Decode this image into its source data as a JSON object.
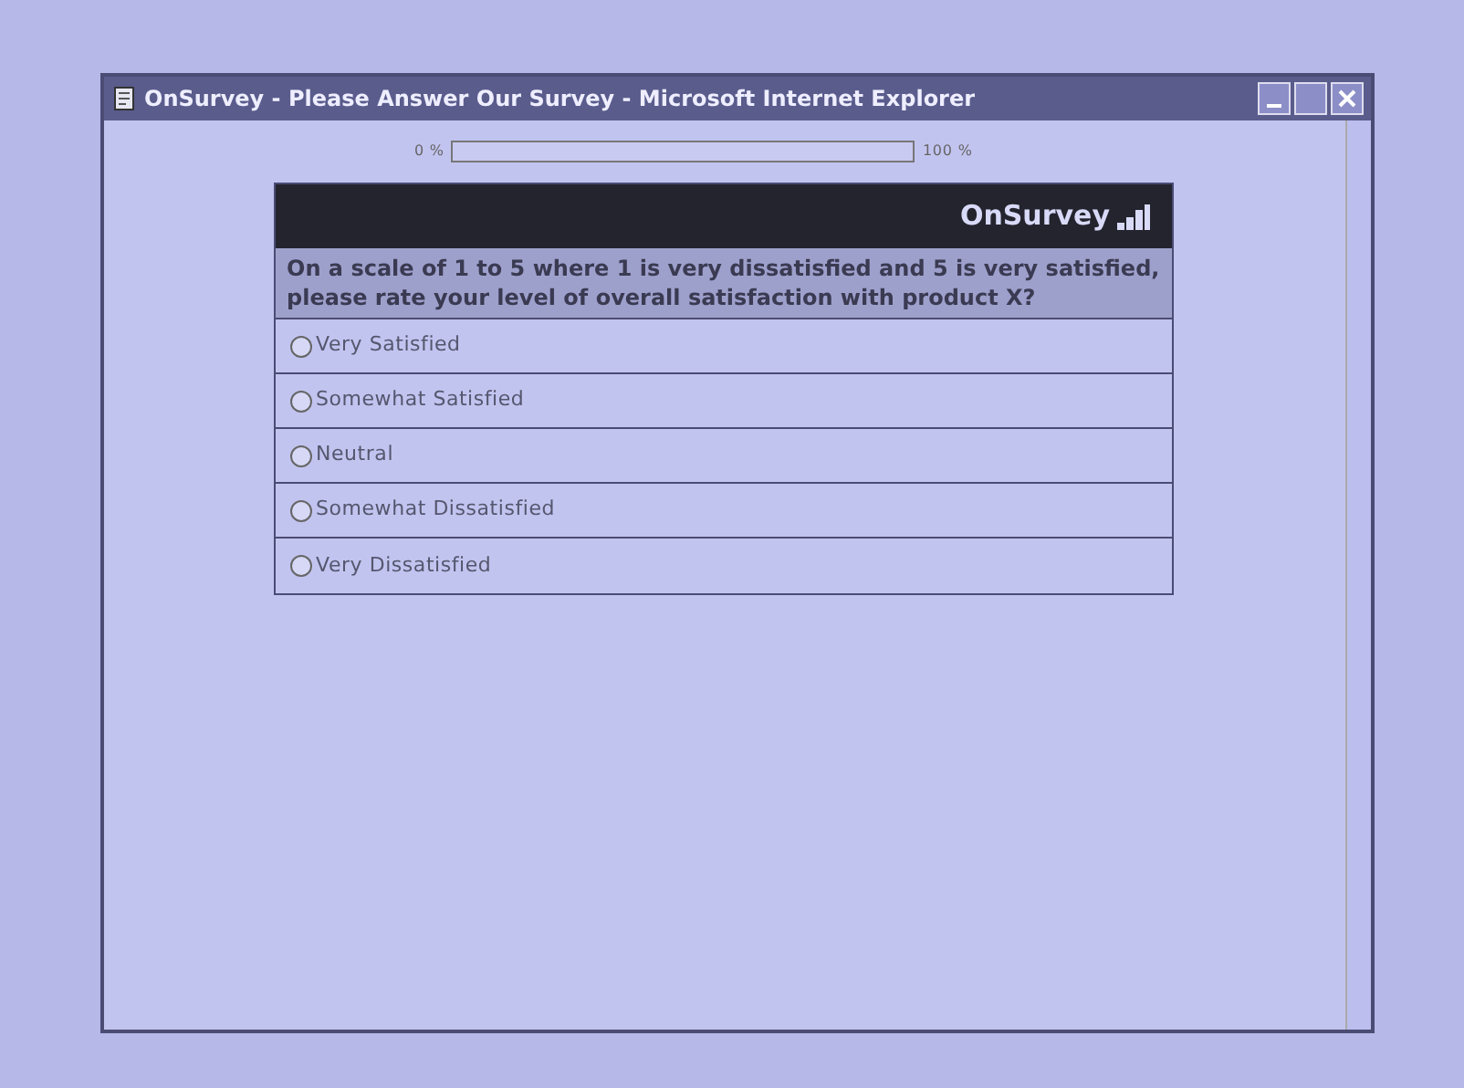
{
  "window": {
    "title": "OnSurvey - Please Answer Our Survey - Microsoft Internet Explorer"
  },
  "progress": {
    "start_label": "0 %",
    "end_label": "100 %",
    "level": 0
  },
  "survey": {
    "brand": "OnSurvey",
    "question": "On a scale of 1 to 5 where 1 is very dissatisfied and 5 is very satisfied, please rate your level of overall satisfaction with product X?",
    "options": [
      {
        "label": "Very Satisfied",
        "selected": false
      },
      {
        "label": "Somewhat Satisfied",
        "selected": false
      },
      {
        "label": "Neutral",
        "selected": false
      },
      {
        "label": "Somewhat Dissatisfied",
        "selected": false
      },
      {
        "label": "Very Dissatisfied",
        "selected": false
      }
    ]
  }
}
